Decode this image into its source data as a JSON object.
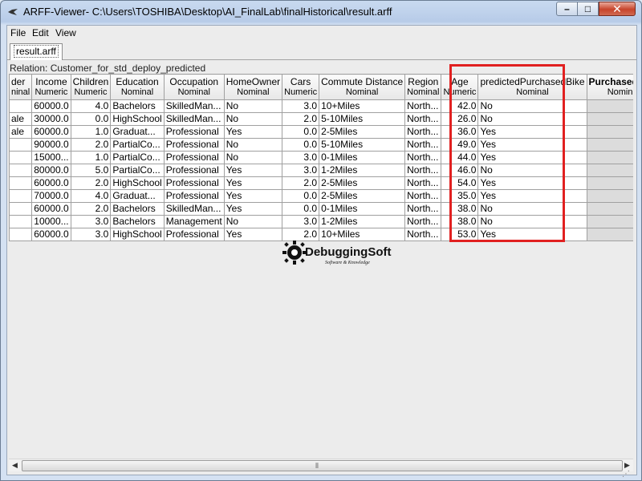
{
  "window": {
    "title": "ARFF-Viewer- C:\\Users\\TOSHIBA\\Desktop\\AI_FinalLab\\finalHistorical\\result.arff"
  },
  "menu": {
    "file": "File",
    "edit": "Edit",
    "view": "View"
  },
  "tab": {
    "label": "result.arff"
  },
  "relation": "Relation: Customer_for_std_deploy_predicted",
  "columns": [
    {
      "name": "der",
      "type": "ninal"
    },
    {
      "name": "Income",
      "type": "Numeric"
    },
    {
      "name": "Children",
      "type": "Numeric"
    },
    {
      "name": "Education",
      "type": "Nominal"
    },
    {
      "name": "Occupation",
      "type": "Nominal"
    },
    {
      "name": "HomeOwner",
      "type": "Nominal"
    },
    {
      "name": "Cars",
      "type": "Numeric"
    },
    {
      "name": "Commute Distance",
      "type": "Nominal"
    },
    {
      "name": "Region",
      "type": "Nominal"
    },
    {
      "name": "Age",
      "type": "Numeric"
    },
    {
      "name": "predictedPurchasedBike",
      "type": "Nominal"
    },
    {
      "name": "PurchasedBike",
      "type": "Nominal"
    }
  ],
  "rows": [
    [
      "",
      "60000.0",
      "4.0",
      "Bachelors",
      "SkilledMan...",
      "No",
      "3.0",
      "10+Miles",
      "North...",
      "42.0",
      "No",
      ""
    ],
    [
      "ale",
      "30000.0",
      "0.0",
      "HighSchool",
      "SkilledMan...",
      "No",
      "2.0",
      "5-10Miles",
      "North...",
      "26.0",
      "No",
      ""
    ],
    [
      "ale",
      "60000.0",
      "1.0",
      "Graduat...",
      "Professional",
      "Yes",
      "0.0",
      "2-5Miles",
      "North...",
      "36.0",
      "Yes",
      ""
    ],
    [
      "",
      "90000.0",
      "2.0",
      "PartialCo...",
      "Professional",
      "No",
      "0.0",
      "5-10Miles",
      "North...",
      "49.0",
      "Yes",
      ""
    ],
    [
      "",
      "15000...",
      "1.0",
      "PartialCo...",
      "Professional",
      "No",
      "3.0",
      "0-1Miles",
      "North...",
      "44.0",
      "Yes",
      ""
    ],
    [
      "",
      "80000.0",
      "5.0",
      "PartialCo...",
      "Professional",
      "Yes",
      "3.0",
      "1-2Miles",
      "North...",
      "46.0",
      "No",
      ""
    ],
    [
      "",
      "60000.0",
      "2.0",
      "HighSchool",
      "Professional",
      "Yes",
      "2.0",
      "2-5Miles",
      "North...",
      "54.0",
      "Yes",
      ""
    ],
    [
      "",
      "70000.0",
      "4.0",
      "Graduat...",
      "Professional",
      "Yes",
      "0.0",
      "2-5Miles",
      "North...",
      "35.0",
      "Yes",
      ""
    ],
    [
      "",
      "60000.0",
      "2.0",
      "Bachelors",
      "SkilledMan...",
      "Yes",
      "0.0",
      "0-1Miles",
      "North...",
      "38.0",
      "No",
      ""
    ],
    [
      "",
      "10000...",
      "3.0",
      "Bachelors",
      "Management",
      "No",
      "3.0",
      "1-2Miles",
      "North...",
      "38.0",
      "No",
      ""
    ],
    [
      "",
      "60000.0",
      "3.0",
      "HighSchool",
      "Professional",
      "Yes",
      "2.0",
      "10+Miles",
      "North...",
      "53.0",
      "Yes",
      ""
    ]
  ],
  "watermark": {
    "brand": "DebuggingSoft",
    "tagline": "Software & Knowledge"
  },
  "colors": {
    "highlight": "#e12020",
    "titlebar": "#b7cbe8",
    "close": "#c7442b"
  },
  "icons": {
    "app": "weka-bird-icon",
    "minimize": "minimize-icon",
    "maximize": "maximize-icon",
    "close": "close-icon"
  }
}
